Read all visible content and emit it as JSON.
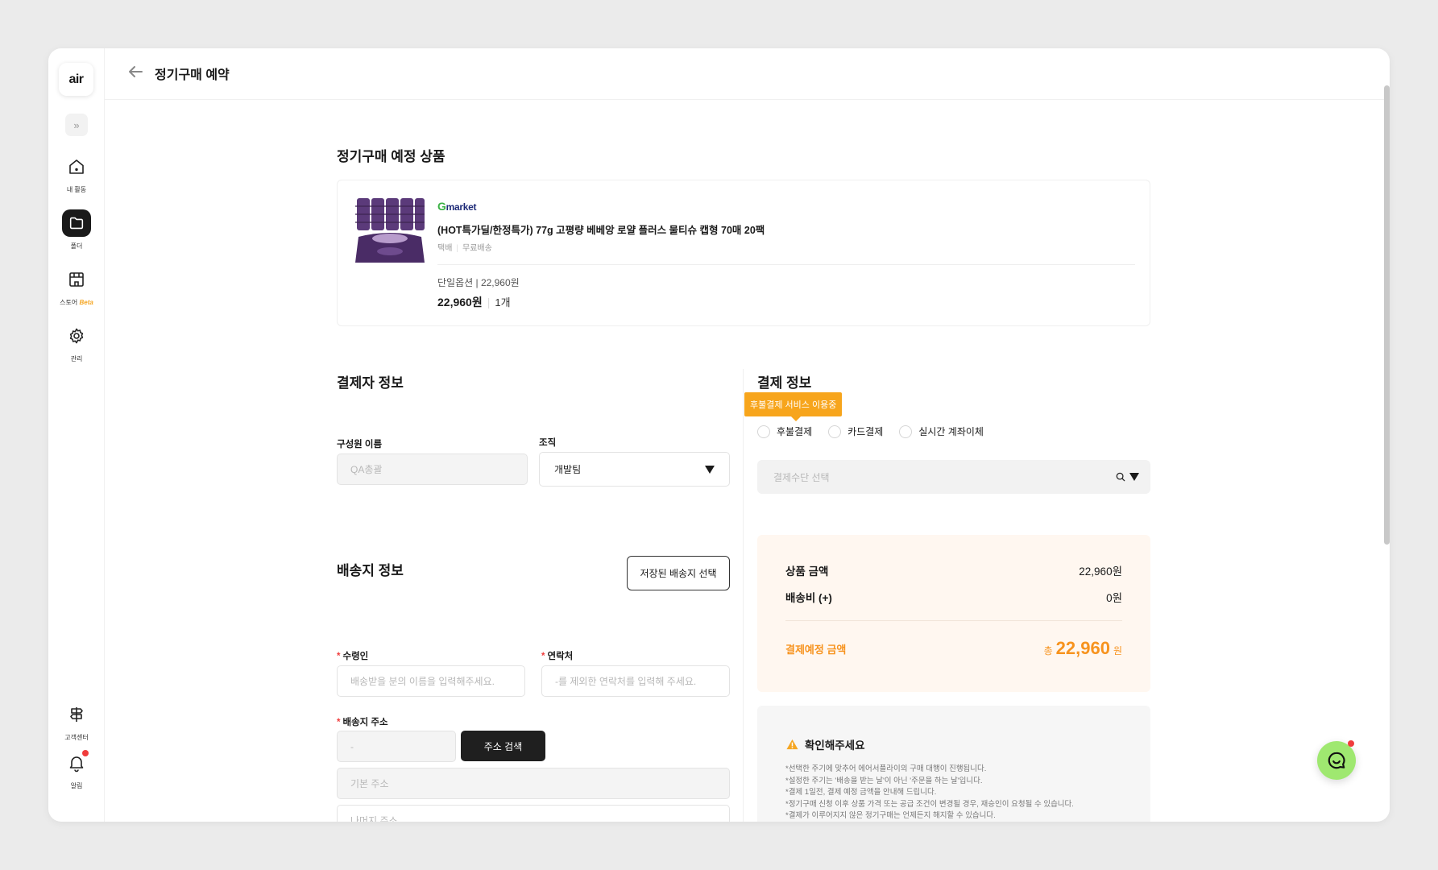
{
  "app": {
    "logo_text": "air"
  },
  "sidebar": {
    "items": [
      {
        "label": "내 활동",
        "icon": "home-icon"
      },
      {
        "label": "폴더",
        "icon": "folder-icon",
        "active": true
      },
      {
        "label": "스토어",
        "badge": "Beta",
        "icon": "store-icon"
      },
      {
        "label": "관리",
        "icon": "gear-icon"
      }
    ],
    "bottom": [
      {
        "label": "고객센터",
        "icon": "signpost-icon"
      },
      {
        "label": "알림",
        "icon": "bell-icon",
        "has_notification": true
      }
    ]
  },
  "header": {
    "title": "정기구매 예약"
  },
  "product_section": {
    "title": "정기구매 예정 상품",
    "store_g": "G",
    "store_rest": "market",
    "name": "(HOT특가딜/한정특가) 77g 고평량 베베앙 로얄 플러스 물티슈 캡형 70매 20팩",
    "shipping_type": "택배",
    "shipping_fee": "무료배송",
    "option": "단일옵션 | 22,960원",
    "price": "22,960원",
    "quantity": "1개"
  },
  "payer_section": {
    "title": "결제자 정보",
    "member_label": "구성원 이름",
    "member_value": "QA총괄",
    "org_label": "조직",
    "org_value": "개발팀"
  },
  "shipping_section": {
    "title": "배송지 정보",
    "saved_button": "저장된 배송지 선택",
    "receiver_label": "수령인",
    "receiver_placeholder": "배송받을 분의 이름을 입력해주세요.",
    "contact_label": "연락처",
    "contact_placeholder": "-를 제외한 연락처를 입력해 주세요.",
    "address_label": "배송지 주소",
    "zip_placeholder": "-",
    "search_button": "주소 검색",
    "base_address_placeholder": "기본 주소",
    "detail_address_placeholder": "나머지 주소"
  },
  "payment_section": {
    "title": "결제 정보",
    "tooltip": "후불결제 서비스 이용중",
    "methods": [
      "후불결제",
      "카드결제",
      "실시간 계좌이체"
    ],
    "select_placeholder": "결제수단 선택"
  },
  "summary": {
    "product_label": "상품 금액",
    "product_value": "22,960원",
    "shipping_label": "배송비 (+)",
    "shipping_value": "0원",
    "total_label": "결제예정 금액",
    "total_prefix": "총",
    "total_value": "22,960",
    "total_unit": "원",
    "accent_color": "#f7931e"
  },
  "notice": {
    "title": "확인해주세요",
    "lines": [
      "*선택한 주기에 맞추어 에어서플라이의 구매 대행이 진행됩니다.",
      "*설정한 주기는 '배송을 받는 날'이 아닌 '주문을 하는 날'입니다.",
      "*결제 1일전, 결제 예정 금액을 안내해 드립니다.",
      "*정기구매 신청 이후 상품 가격 또는 공급 조건이 변경될 경우, 재승인이 요청될 수 있습니다.",
      "*결제가 이루어지지 않은 정기구매는 언제든지 해지할 수 있습니다."
    ]
  }
}
